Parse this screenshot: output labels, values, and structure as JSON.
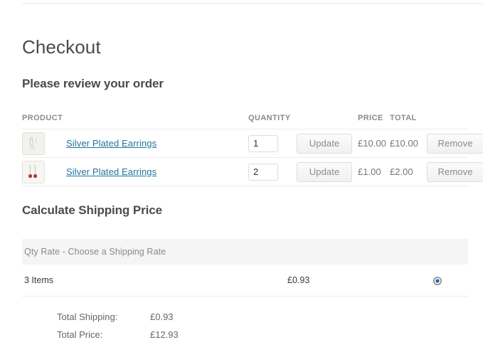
{
  "page": {
    "title": "Checkout",
    "review_heading": "Please review your order",
    "shipping_heading": "Calculate Shipping Price"
  },
  "cart": {
    "headers": {
      "product": "PRODUCT",
      "quantity": "QUANTITY",
      "price": "PRICE",
      "total": "TOTAL"
    },
    "rows": [
      {
        "thumb_icon": "earrings-thumbnail",
        "name": "Silver Plated Earrings",
        "qty": "1",
        "update_label": "Update",
        "price": "£10.00",
        "total": "£10.00",
        "remove_label": "Remove"
      },
      {
        "thumb_icon": "earrings-thumbnail",
        "name": "Silver Plated Earrings",
        "qty": "2",
        "update_label": "Update",
        "price": "£1.00",
        "total": "£2.00",
        "remove_label": "Remove"
      }
    ]
  },
  "shipping": {
    "rate_group_label": "Qty Rate - Choose a Shipping Rate",
    "rates": [
      {
        "label": "3 Items",
        "price": "£0.93",
        "selected": true
      }
    ]
  },
  "totals": [
    {
      "label": "Total Shipping:",
      "value": "£0.93"
    },
    {
      "label": "Total Price:",
      "value": "£12.93"
    }
  ],
  "colors": {
    "link": "#21759b",
    "heading": "#4a4a4a",
    "muted": "#8a8a8a",
    "rule": "#ececec",
    "rate_header_bg": "#f5f5f5",
    "radio_accent": "#1e6bb8"
  }
}
